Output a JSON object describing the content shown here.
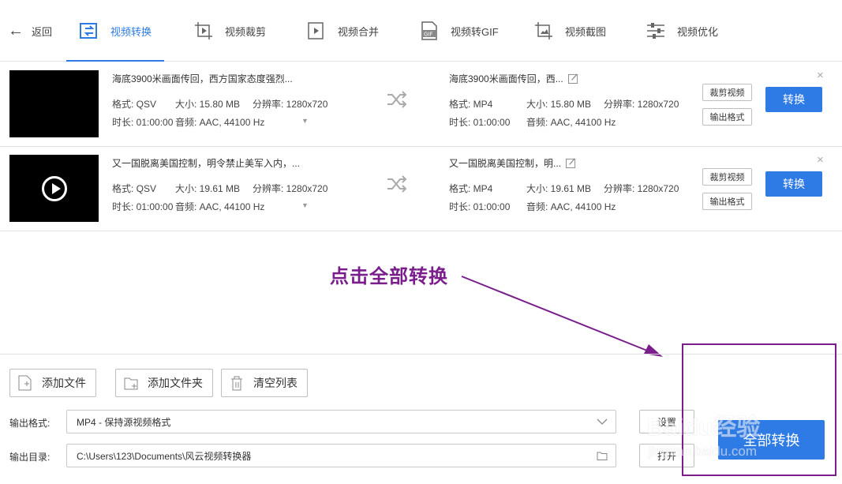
{
  "toolbar": {
    "back": "返回",
    "tabs": [
      {
        "label": "视频转换",
        "icon": "convert-icon",
        "active": true
      },
      {
        "label": "视频裁剪",
        "icon": "crop-icon"
      },
      {
        "label": "视频合并",
        "icon": "merge-icon"
      },
      {
        "label": "视频转GIF",
        "icon": "gif-icon"
      },
      {
        "label": "视频截图",
        "icon": "screenshot-icon"
      },
      {
        "label": "视频优化",
        "icon": "sliders-icon"
      }
    ]
  },
  "files": [
    {
      "thumbnail": "black",
      "source": {
        "title": "海底3900米画面传回，西方国家态度强烈...",
        "format": "格式: QSV",
        "size": "大小: 15.80 MB",
        "resolution": "分辨率: 1280x720",
        "duration": "时长: 01:00:00",
        "audio": "音频: AAC, 44100 Hz"
      },
      "output": {
        "title": "海底3900米画面传回，西...",
        "format": "格式: MP4",
        "size": "大小: 15.80 MB",
        "resolution": "分辨率: 1280x720",
        "duration": "时长: 01:00:00",
        "audio": "音频: AAC, 44100 Hz"
      },
      "crop_label": "裁剪视频",
      "format_label": "输出格式",
      "convert_label": "转换",
      "close": "×"
    },
    {
      "thumbnail": "play",
      "source": {
        "title": "又一国脱离美国控制，明令禁止美军入内，...",
        "format": "格式: QSV",
        "size": "大小: 19.61 MB",
        "resolution": "分辨率: 1280x720",
        "duration": "时长: 01:00:00",
        "audio": "音频: AAC, 44100 Hz"
      },
      "output": {
        "title": "又一国脱离美国控制，明...",
        "format": "格式: MP4",
        "size": "大小: 19.61 MB",
        "resolution": "分辨率: 1280x720",
        "duration": "时长: 01:00:00",
        "audio": "音频: AAC, 44100 Hz"
      },
      "crop_label": "裁剪视频",
      "format_label": "输出格式",
      "convert_label": "转换",
      "close": "×"
    }
  ],
  "annotation": {
    "text": "点击全部转换",
    "color": "#7a1e8c"
  },
  "actions": {
    "add_file": "添加文件",
    "add_folder": "添加文件夹",
    "clear_list": "清空列表"
  },
  "output": {
    "format_label": "输出格式:",
    "format_value": "MP4 - 保持源视频格式",
    "dir_label": "输出目录:",
    "dir_value": "C:\\Users\\123\\Documents\\风云视频转换器",
    "settings_label": "设置",
    "open_label": "打开",
    "convert_all_label": "全部转换"
  },
  "watermark": {
    "brand": "Baidu经验",
    "url": "jingyan.baidu.com"
  },
  "colors": {
    "accent": "#2f7be5",
    "annotation": "#7a1e8c"
  }
}
